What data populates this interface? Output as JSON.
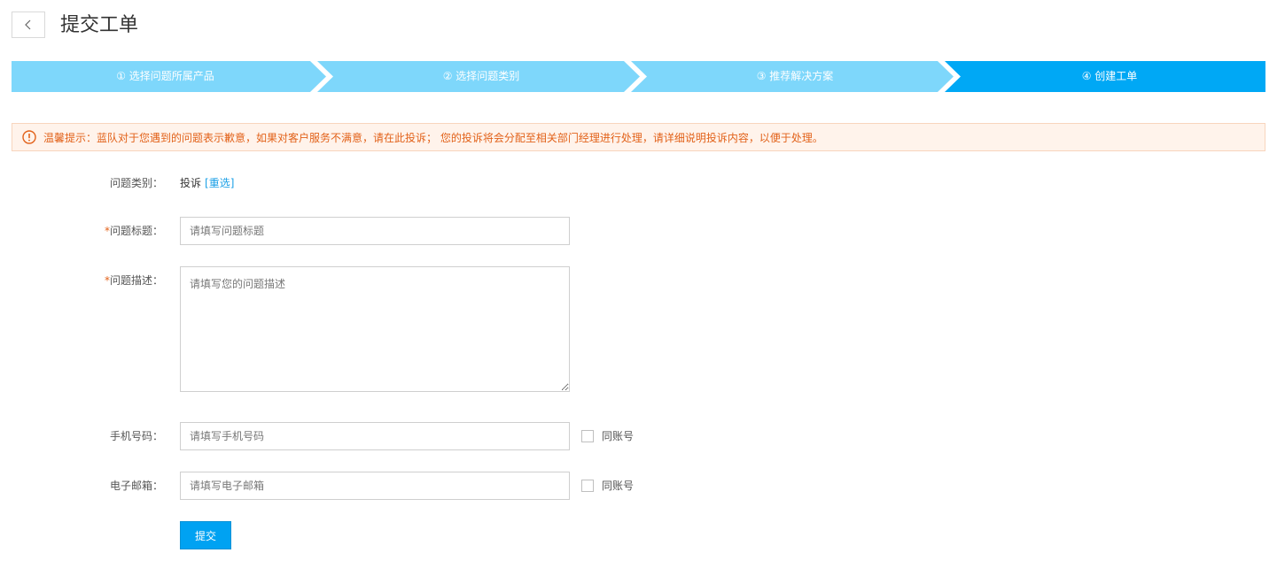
{
  "header": {
    "title": "提交工单",
    "back_icon": "chevron-left-icon"
  },
  "steps": [
    {
      "label": "① 选择问题所属产品",
      "active": false
    },
    {
      "label": "② 选择问题类别",
      "active": false
    },
    {
      "label": "③ 推荐解决方案",
      "active": false
    },
    {
      "label": "④ 创建工单",
      "active": true
    }
  ],
  "colors": {
    "step_inactive": "#7ed7fb",
    "step_active": "#00a8f5",
    "notice_text": "#e2621a",
    "link": "#1a9fe6",
    "button": "#00a2f2"
  },
  "notice": {
    "icon": "warning-circle-icon",
    "text": "温馨提示：蓝队对于您遇到的问题表示歉意，如果对客户服务不满意，请在此投诉； 您的投诉将会分配至相关部门经理进行处理，请详细说明投诉内容，以便于处理。"
  },
  "form": {
    "category": {
      "label": "问题类别：",
      "value": "投诉",
      "reselect": "[重选]"
    },
    "title": {
      "required_mark": "*",
      "label": "问题标题：",
      "value": "",
      "placeholder": "请填写问题标题"
    },
    "description": {
      "required_mark": "*",
      "label": "问题描述：",
      "value": "",
      "placeholder": "请填写您的问题描述"
    },
    "phone": {
      "label": "手机号码：",
      "value": "",
      "placeholder": "请填写手机号码",
      "checkbox_label": "同账号",
      "checked": false
    },
    "email": {
      "label": "电子邮箱：",
      "value": "",
      "placeholder": "请填写电子邮箱",
      "checkbox_label": "同账号",
      "checked": false
    },
    "submit_label": "提交"
  }
}
